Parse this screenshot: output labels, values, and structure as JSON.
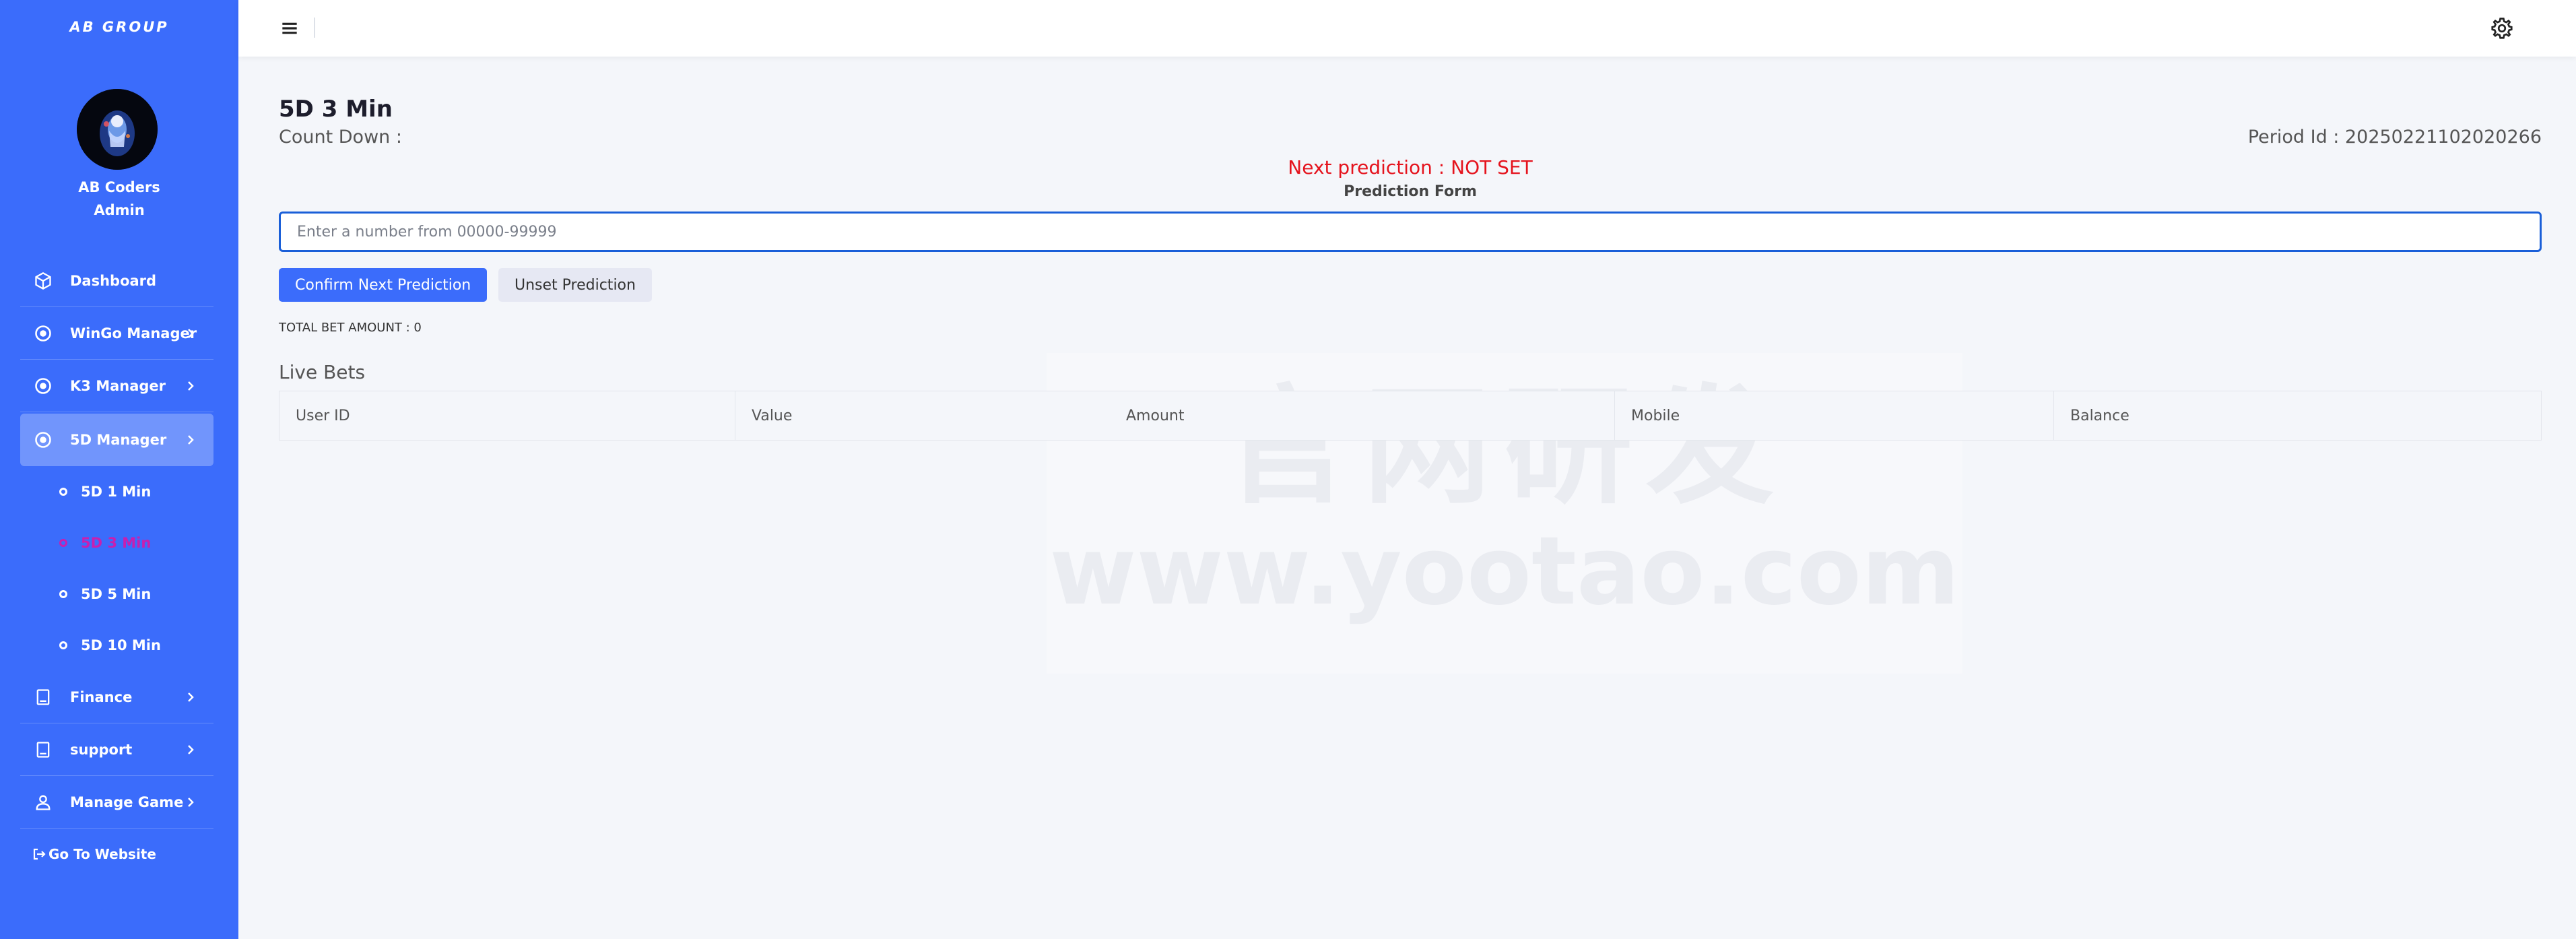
{
  "sidebar": {
    "brand": "AB GROUP",
    "user_name": "AB Coders",
    "user_role": "Admin",
    "items": {
      "dashboard": "Dashboard",
      "wingo": "WinGo Manager",
      "k3": "K3 Manager",
      "fived": "5D Manager",
      "finance": "Finance",
      "support": "support",
      "manage_game": "Manage Game"
    },
    "sub_items": [
      "5D 1 Min",
      "5D 3 Min",
      "5D 5 Min",
      "5D 10 Min"
    ],
    "go_website": "Go To Website"
  },
  "page": {
    "title": "5D 3 Min",
    "countdown_label": "Count Down :",
    "period_label": "Period Id : 20250221102020266",
    "next_prediction": "Next prediction : NOT SET",
    "form_label": "Prediction Form",
    "input_placeholder": "Enter a number from 00000-99999",
    "confirm_button": "Confirm Next Prediction",
    "unset_button": "Unset Prediction",
    "total_bet": "TOTAL BET AMOUNT : 0",
    "live_bets_title": "Live Bets",
    "table_headers": [
      "User ID",
      "Value",
      "Amount",
      "Mobile",
      "Balance"
    ]
  },
  "watermark": {
    "line1": "官网研发",
    "line2": "www.yootao.com"
  },
  "colors": {
    "sidebar": "#3b6cfb",
    "accent": "#3b6cfb",
    "active_sub": "#c81fb0",
    "prediction": "#e5131d"
  }
}
